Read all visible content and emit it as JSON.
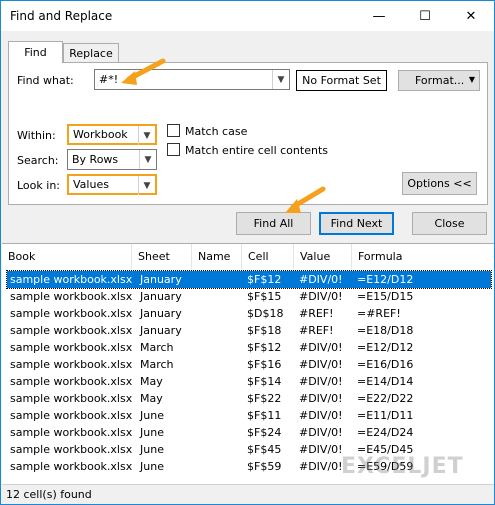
{
  "window": {
    "title": "Find and Replace"
  },
  "tabs": [
    {
      "label": "Find"
    },
    {
      "label": "Replace"
    }
  ],
  "find": {
    "find_what_label": "Find what:",
    "find_what_value": "#*!",
    "format_status": "No Format Set",
    "format_button": "Format...",
    "within_label": "Within:",
    "within_value": "Workbook",
    "search_label": "Search:",
    "search_value": "By Rows",
    "look_in_label": "Look in:",
    "look_in_value": "Values",
    "match_case_label": "Match case",
    "match_entire_label": "Match entire cell contents",
    "options_button": "Options <<"
  },
  "actions": {
    "find_all": "Find All",
    "find_next": "Find Next",
    "close": "Close"
  },
  "results": {
    "columns": [
      "Book",
      "Sheet",
      "Name",
      "Cell",
      "Value",
      "Formula"
    ],
    "rows": [
      {
        "book": "sample workbook.xlsx",
        "sheet": "January",
        "name": "",
        "cell": "$F$12",
        "value": "#DIV/0!",
        "formula": "=E12/D12"
      },
      {
        "book": "sample workbook.xlsx",
        "sheet": "January",
        "name": "",
        "cell": "$F$15",
        "value": "#DIV/0!",
        "formula": "=E15/D15"
      },
      {
        "book": "sample workbook.xlsx",
        "sheet": "January",
        "name": "",
        "cell": "$D$18",
        "value": "#REF!",
        "formula": "=#REF!"
      },
      {
        "book": "sample workbook.xlsx",
        "sheet": "January",
        "name": "",
        "cell": "$F$18",
        "value": "#REF!",
        "formula": "=E18/D18"
      },
      {
        "book": "sample workbook.xlsx",
        "sheet": "March",
        "name": "",
        "cell": "$F$12",
        "value": "#DIV/0!",
        "formula": "=E12/D12"
      },
      {
        "book": "sample workbook.xlsx",
        "sheet": "March",
        "name": "",
        "cell": "$F$16",
        "value": "#DIV/0!",
        "formula": "=E16/D16"
      },
      {
        "book": "sample workbook.xlsx",
        "sheet": "May",
        "name": "",
        "cell": "$F$14",
        "value": "#DIV/0!",
        "formula": "=E14/D14"
      },
      {
        "book": "sample workbook.xlsx",
        "sheet": "May",
        "name": "",
        "cell": "$F$22",
        "value": "#DIV/0!",
        "formula": "=E22/D22"
      },
      {
        "book": "sample workbook.xlsx",
        "sheet": "June",
        "name": "",
        "cell": "$F$11",
        "value": "#DIV/0!",
        "formula": "=E11/D11"
      },
      {
        "book": "sample workbook.xlsx",
        "sheet": "June",
        "name": "",
        "cell": "$F$24",
        "value": "#DIV/0!",
        "formula": "=E24/D24"
      },
      {
        "book": "sample workbook.xlsx",
        "sheet": "June",
        "name": "",
        "cell": "$F$45",
        "value": "#DIV/0!",
        "formula": "=E45/D45"
      },
      {
        "book": "sample workbook.xlsx",
        "sheet": "June",
        "name": "",
        "cell": "$F$59",
        "value": "#DIV/0!",
        "formula": "=E59/D59"
      }
    ]
  },
  "status": {
    "text": "12 cell(s) found"
  },
  "watermark": {
    "text": "EXCELJET"
  },
  "colors": {
    "accent": "#0078d7",
    "highlight": "#f5a11c"
  }
}
